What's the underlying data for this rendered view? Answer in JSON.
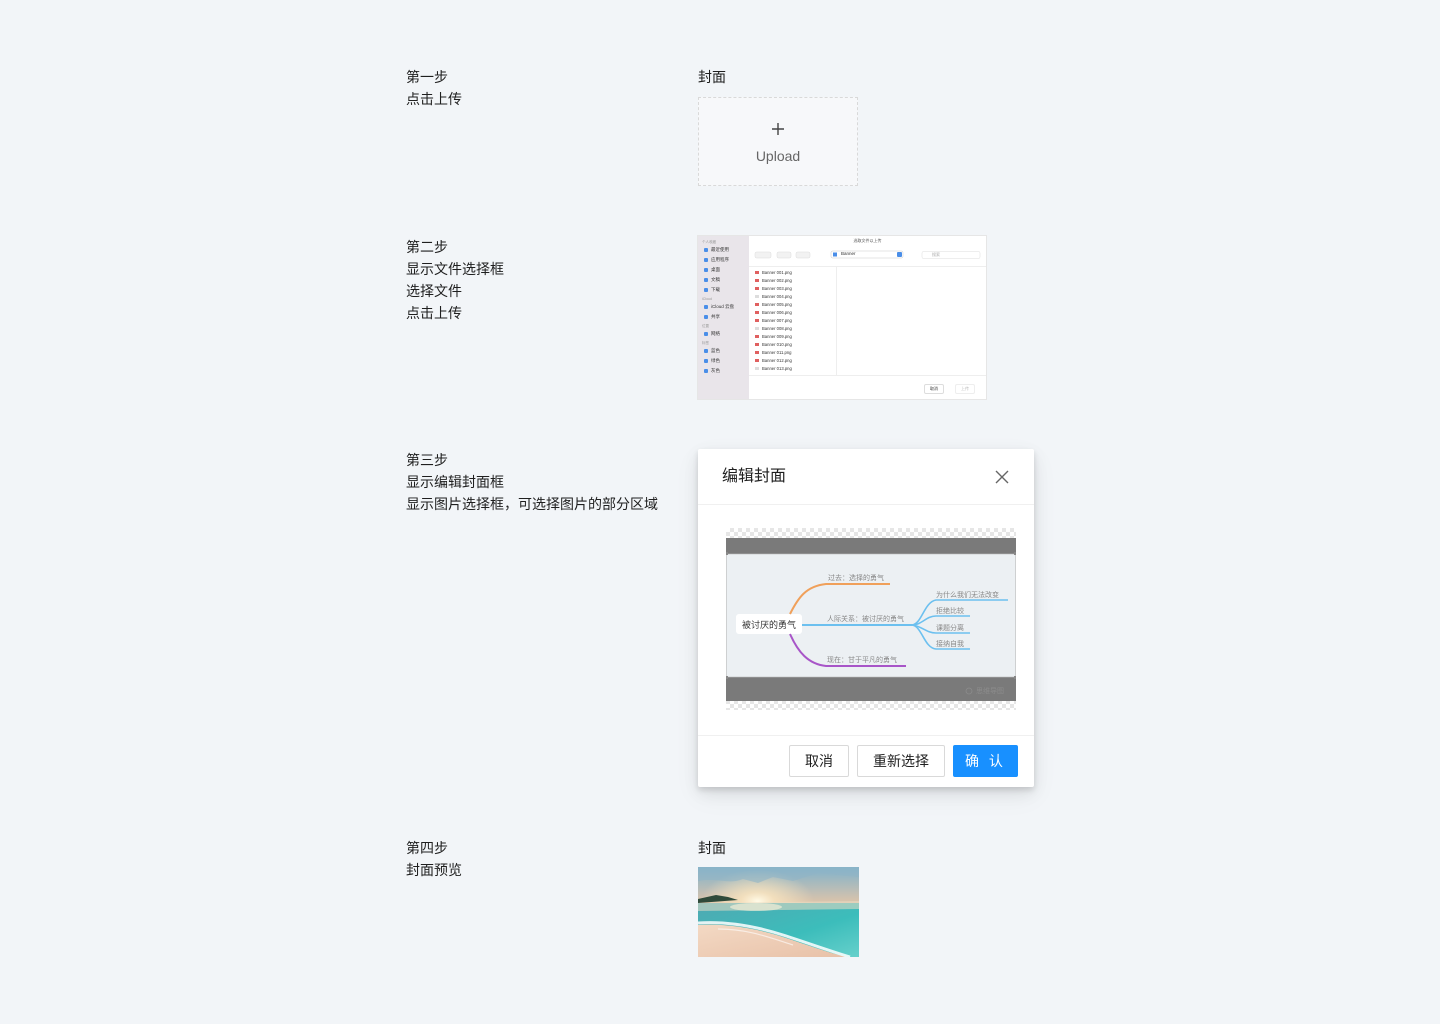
{
  "steps": [
    {
      "lines": [
        "第一步",
        "点击上传"
      ]
    },
    {
      "lines": [
        "第二步",
        "显示文件选择框",
        "选择文件",
        "点击上传"
      ]
    },
    {
      "lines": [
        "第三步",
        "显示编辑封面框",
        "显示图片选择框，可选择图片的部分区域"
      ]
    },
    {
      "lines": [
        "第四步",
        "封面预览"
      ]
    }
  ],
  "step1": {
    "label": "封面",
    "upload_icon": "plus-icon",
    "upload_text": "Upload"
  },
  "step2": {
    "picker": {
      "title": "选取文件以上传",
      "location": "Banner",
      "search_placeholder": "搜索",
      "sidebar": [
        {
          "section": "个人收藏"
        },
        {
          "item": "最近使用"
        },
        {
          "item": "应用程序"
        },
        {
          "item": "桌面"
        },
        {
          "item": "文稿"
        },
        {
          "item": "下载"
        },
        {
          "section": "iCloud"
        },
        {
          "item": "iCloud 云盘"
        },
        {
          "item": "共享"
        },
        {
          "section": "位置"
        },
        {
          "item": "网络"
        },
        {
          "section": "标签"
        },
        {
          "item": "蓝色"
        },
        {
          "item": "绿色"
        },
        {
          "item": "灰色"
        }
      ],
      "files": [
        "Banner 001.png",
        "Banner 002.png",
        "Banner 003.png",
        "Banner 004.png",
        "Banner 005.png",
        "Banner 006.png",
        "Banner 007.png",
        "Banner 008.png",
        "Banner 009.png",
        "Banner 010.png",
        "Banner 011.png",
        "Banner 012.png",
        "Banner 013.png"
      ],
      "cancel_label": "取消",
      "upload_label": "上传"
    }
  },
  "step3": {
    "modal": {
      "title": "编辑封面",
      "close_icon": "close-icon",
      "cancel_label": "取消",
      "reselect_label": "重新选择",
      "confirm_label": "确 认"
    },
    "mindmap": {
      "root": "被讨厌的勇气",
      "branches": [
        {
          "label": "过去：选择的勇气",
          "color": "#f0a05a"
        },
        {
          "label": "人际关系：被讨厌的勇气",
          "color": "#6cc0ef"
        },
        {
          "label": "现在：甘于平凡的勇气",
          "color": "#a855c8"
        }
      ],
      "sub_branches": [
        "为什么我们无法改变",
        "拒绝比较",
        "课题分离",
        "接纳自我"
      ],
      "watermark": "思维导图"
    }
  },
  "step4": {
    "label": "封面"
  },
  "colors": {
    "page_bg": "#f2f5f8",
    "primary": "#1890ff"
  }
}
